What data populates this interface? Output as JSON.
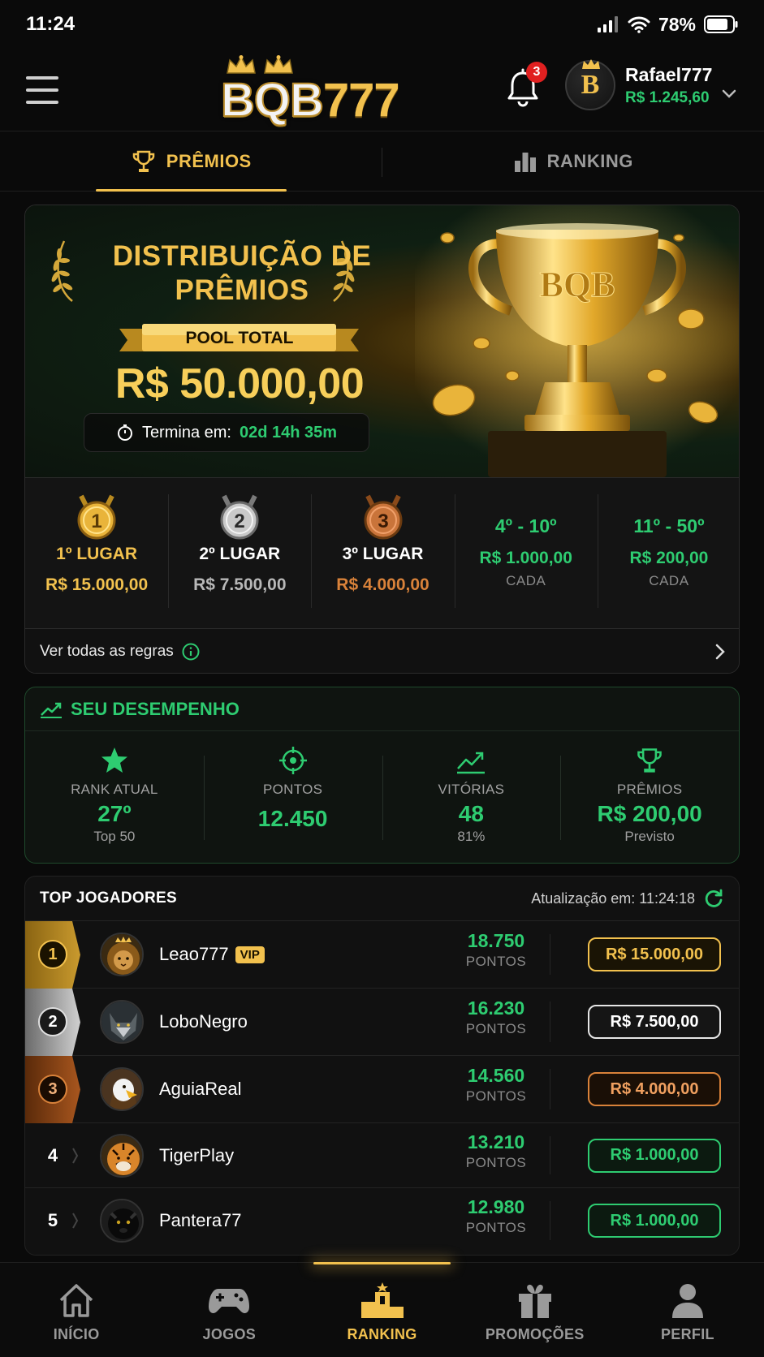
{
  "status_bar": {
    "time": "11:24",
    "battery": "78%"
  },
  "header": {
    "logo_a": "BQB",
    "logo_b": "777",
    "notifications_count": "3",
    "user_name": "Rafael777",
    "user_balance": "R$ 1.245,60",
    "avatar_letter": "B"
  },
  "tabs": [
    {
      "label": "PRÊMIOS",
      "icon": "trophy-icon",
      "active": true
    },
    {
      "label": "RANKING",
      "icon": "bar-chart-icon",
      "active": false
    }
  ],
  "prize": {
    "title_line1": "DISTRIBUIÇÃO DE",
    "title_line2": "PRÊMIOS",
    "pool_label": "POOL TOTAL",
    "pool_amount": "R$ 50.000,00",
    "timer_label": "Termina em:",
    "timer_value": "02d 14h 35m",
    "trophy_text": "BQB",
    "places": [
      {
        "medal": "1",
        "label": "1º LUGAR",
        "value": "R$ 15.000,00",
        "color": "#f2c14e"
      },
      {
        "medal": "2",
        "label": "2º LUGAR",
        "value": "R$ 7.500,00",
        "color": "#b8b8b8"
      },
      {
        "medal": "3",
        "label": "3º LUGAR",
        "value": "R$ 4.000,00",
        "color": "#d9823a"
      },
      {
        "range": "4º - 10º",
        "value": "R$ 1.000,00",
        "per": "CADA"
      },
      {
        "range": "11º - 50º",
        "value": "R$ 200,00",
        "per": "CADA"
      }
    ],
    "rules_link": "Ver todas as regras"
  },
  "performance": {
    "title": "SEU DESEMPENHO",
    "stats": [
      {
        "icon": "star-icon",
        "label": "RANK ATUAL",
        "value": "27º",
        "sub": "Top 50"
      },
      {
        "icon": "target-icon",
        "label": "PONTOS",
        "value": "12.450",
        "sub": ""
      },
      {
        "icon": "trend-up-icon",
        "label": "VITÓRIAS",
        "value": "48",
        "sub": "81%"
      },
      {
        "icon": "trophy-icon",
        "label": "PRÊMIOS",
        "value": "R$ 200,00",
        "sub": "Previsto"
      }
    ]
  },
  "top_players": {
    "title": "TOP JOGADORES",
    "update_label": "Atualização em: 11:24:18",
    "points_unit": "PONTOS",
    "rows": [
      {
        "rank": "1",
        "name": "Leao777",
        "badge": "VIP",
        "points": "18.750",
        "prize": "R$ 15.000,00",
        "avatar": "lion"
      },
      {
        "rank": "2",
        "name": "LoboNegro",
        "badge": "",
        "points": "16.230",
        "prize": "R$ 7.500,00",
        "avatar": "wolf"
      },
      {
        "rank": "3",
        "name": "AguiaReal",
        "badge": "",
        "points": "14.560",
        "prize": "R$ 4.000,00",
        "avatar": "eagle"
      },
      {
        "rank": "4",
        "name": "TigerPlay",
        "badge": "",
        "points": "13.210",
        "prize": "R$ 1.000,00",
        "avatar": "tiger"
      },
      {
        "rank": "5",
        "name": "Pantera77",
        "badge": "",
        "points": "12.980",
        "prize": "R$ 1.000,00",
        "avatar": "panther"
      }
    ]
  },
  "bottom_nav": [
    {
      "label": "INÍCIO",
      "icon": "home-icon",
      "active": false
    },
    {
      "label": "JOGOS",
      "icon": "gamepad-icon",
      "active": false
    },
    {
      "label": "RANKING",
      "icon": "podium-icon",
      "active": true
    },
    {
      "label": "PROMOÇÕES",
      "icon": "gift-icon",
      "active": false
    },
    {
      "label": "PERFIL",
      "icon": "user-icon",
      "active": false
    }
  ]
}
